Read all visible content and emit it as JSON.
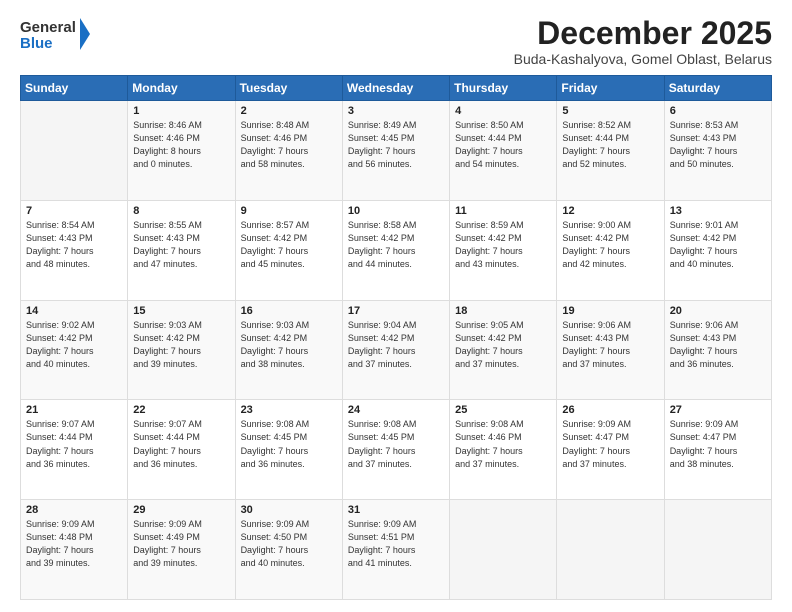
{
  "logo": {
    "line1": "General",
    "line2": "Blue"
  },
  "title": "December 2025",
  "subtitle": "Buda-Kashalyova, Gomel Oblast, Belarus",
  "days_header": [
    "Sunday",
    "Monday",
    "Tuesday",
    "Wednesday",
    "Thursday",
    "Friday",
    "Saturday"
  ],
  "weeks": [
    [
      {
        "day": "",
        "info": ""
      },
      {
        "day": "1",
        "info": "Sunrise: 8:46 AM\nSunset: 4:46 PM\nDaylight: 8 hours\nand 0 minutes."
      },
      {
        "day": "2",
        "info": "Sunrise: 8:48 AM\nSunset: 4:46 PM\nDaylight: 7 hours\nand 58 minutes."
      },
      {
        "day": "3",
        "info": "Sunrise: 8:49 AM\nSunset: 4:45 PM\nDaylight: 7 hours\nand 56 minutes."
      },
      {
        "day": "4",
        "info": "Sunrise: 8:50 AM\nSunset: 4:44 PM\nDaylight: 7 hours\nand 54 minutes."
      },
      {
        "day": "5",
        "info": "Sunrise: 8:52 AM\nSunset: 4:44 PM\nDaylight: 7 hours\nand 52 minutes."
      },
      {
        "day": "6",
        "info": "Sunrise: 8:53 AM\nSunset: 4:43 PM\nDaylight: 7 hours\nand 50 minutes."
      }
    ],
    [
      {
        "day": "7",
        "info": "Sunrise: 8:54 AM\nSunset: 4:43 PM\nDaylight: 7 hours\nand 48 minutes."
      },
      {
        "day": "8",
        "info": "Sunrise: 8:55 AM\nSunset: 4:43 PM\nDaylight: 7 hours\nand 47 minutes."
      },
      {
        "day": "9",
        "info": "Sunrise: 8:57 AM\nSunset: 4:42 PM\nDaylight: 7 hours\nand 45 minutes."
      },
      {
        "day": "10",
        "info": "Sunrise: 8:58 AM\nSunset: 4:42 PM\nDaylight: 7 hours\nand 44 minutes."
      },
      {
        "day": "11",
        "info": "Sunrise: 8:59 AM\nSunset: 4:42 PM\nDaylight: 7 hours\nand 43 minutes."
      },
      {
        "day": "12",
        "info": "Sunrise: 9:00 AM\nSunset: 4:42 PM\nDaylight: 7 hours\nand 42 minutes."
      },
      {
        "day": "13",
        "info": "Sunrise: 9:01 AM\nSunset: 4:42 PM\nDaylight: 7 hours\nand 40 minutes."
      }
    ],
    [
      {
        "day": "14",
        "info": "Sunrise: 9:02 AM\nSunset: 4:42 PM\nDaylight: 7 hours\nand 40 minutes."
      },
      {
        "day": "15",
        "info": "Sunrise: 9:03 AM\nSunset: 4:42 PM\nDaylight: 7 hours\nand 39 minutes."
      },
      {
        "day": "16",
        "info": "Sunrise: 9:03 AM\nSunset: 4:42 PM\nDaylight: 7 hours\nand 38 minutes."
      },
      {
        "day": "17",
        "info": "Sunrise: 9:04 AM\nSunset: 4:42 PM\nDaylight: 7 hours\nand 37 minutes."
      },
      {
        "day": "18",
        "info": "Sunrise: 9:05 AM\nSunset: 4:42 PM\nDaylight: 7 hours\nand 37 minutes."
      },
      {
        "day": "19",
        "info": "Sunrise: 9:06 AM\nSunset: 4:43 PM\nDaylight: 7 hours\nand 37 minutes."
      },
      {
        "day": "20",
        "info": "Sunrise: 9:06 AM\nSunset: 4:43 PM\nDaylight: 7 hours\nand 36 minutes."
      }
    ],
    [
      {
        "day": "21",
        "info": "Sunrise: 9:07 AM\nSunset: 4:44 PM\nDaylight: 7 hours\nand 36 minutes."
      },
      {
        "day": "22",
        "info": "Sunrise: 9:07 AM\nSunset: 4:44 PM\nDaylight: 7 hours\nand 36 minutes."
      },
      {
        "day": "23",
        "info": "Sunrise: 9:08 AM\nSunset: 4:45 PM\nDaylight: 7 hours\nand 36 minutes."
      },
      {
        "day": "24",
        "info": "Sunrise: 9:08 AM\nSunset: 4:45 PM\nDaylight: 7 hours\nand 37 minutes."
      },
      {
        "day": "25",
        "info": "Sunrise: 9:08 AM\nSunset: 4:46 PM\nDaylight: 7 hours\nand 37 minutes."
      },
      {
        "day": "26",
        "info": "Sunrise: 9:09 AM\nSunset: 4:47 PM\nDaylight: 7 hours\nand 37 minutes."
      },
      {
        "day": "27",
        "info": "Sunrise: 9:09 AM\nSunset: 4:47 PM\nDaylight: 7 hours\nand 38 minutes."
      }
    ],
    [
      {
        "day": "28",
        "info": "Sunrise: 9:09 AM\nSunset: 4:48 PM\nDaylight: 7 hours\nand 39 minutes."
      },
      {
        "day": "29",
        "info": "Sunrise: 9:09 AM\nSunset: 4:49 PM\nDaylight: 7 hours\nand 39 minutes."
      },
      {
        "day": "30",
        "info": "Sunrise: 9:09 AM\nSunset: 4:50 PM\nDaylight: 7 hours\nand 40 minutes."
      },
      {
        "day": "31",
        "info": "Sunrise: 9:09 AM\nSunset: 4:51 PM\nDaylight: 7 hours\nand 41 minutes."
      },
      {
        "day": "",
        "info": ""
      },
      {
        "day": "",
        "info": ""
      },
      {
        "day": "",
        "info": ""
      }
    ]
  ]
}
